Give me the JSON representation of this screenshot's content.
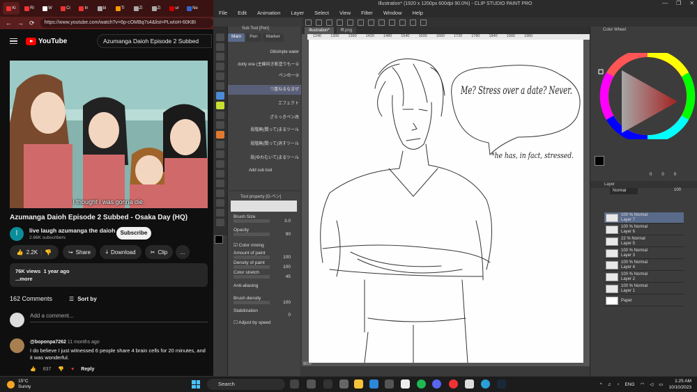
{
  "browser": {
    "tabs": [
      "Ki",
      "Rl",
      "W",
      "Ci",
      "In",
      "bi",
      "Tl",
      "Zi",
      "Zi",
      "ur",
      "Ne"
    ],
    "url": "https://www.youtube.com/watch?v=6p-cOMBq7s4&list=PLwIoH-60KBI",
    "logo": "YouTube",
    "search_value": "Azumanga Daioh Episode 2 Subbed",
    "subtitle": "I thought I was gonna die.",
    "video_title": "Azumanga Daioh Episode 2 Subbed - Osaka Day (HQ)",
    "channel_initial": "l",
    "channel_name": "live laugh azumanga the daioh",
    "subscribers": "2.66K subscribers",
    "subscribe_label": "Subscribe",
    "likes": "2.2K",
    "share_label": "Share",
    "download_label": "Download",
    "clip_label": "Clip",
    "more_label": "...",
    "views": "76K views",
    "age": "1 year ago",
    "more_desc": "...more",
    "comments_count": "162 Comments",
    "sort_label": "Sort by",
    "add_comment_placeholder": "Add a comment...",
    "comment": {
      "author": "@boponpa7262",
      "time": "11 months ago",
      "text": "I do believe I just witnessed 6 people share 4 brain cells for 20 minutes, and it was wonderful.",
      "likes": "837",
      "reply_label": "Reply"
    }
  },
  "csp": {
    "title": "Illustration* (1920 x 1200px 600dpi 90.0%) - CLIP STUDIO PAINT PRO",
    "menu": [
      "File",
      "Edit",
      "Animation",
      "Layer",
      "Select",
      "View",
      "Filter",
      "Window",
      "Help"
    ],
    "subtool_header": "Sub Tool [Pen]",
    "subtool_tabs": [
      "Main",
      "Pen",
      "Marker"
    ],
    "brushes": [
      "G8simple water",
      "dotty one (主線向き影塗りもー①",
      "ペンの一②",
      "つ重ねるなまぜ",
      "エフェクト",
      "ざらっきペン改",
      "段階無(間って)まるツール",
      "段階無(間って)消すツール",
      "段(ゆわむいて)まるツール"
    ],
    "add_subtool": "Add sub tool",
    "tool_property_header": "Tool property [G-ペン]",
    "props": {
      "brush_size_label": "Brush Size",
      "brush_size": "3.0",
      "opacity_label": "Opacity",
      "opacity": "90",
      "color_mixing_label": "Color mixing",
      "amount_label": "Amount of paint",
      "amount": "100",
      "density_label": "Density of paint",
      "density": "100",
      "stretch_label": "Color stretch",
      "stretch": "45",
      "antialias_label": "Anti-aliasing",
      "brush_density_label": "Brush density",
      "brush_density": "100",
      "stabilization_label": "Stabilization",
      "stabilization": "0",
      "adjust_speed_label": "Adjust by speed"
    },
    "canvas_tabs": [
      "Illustration*",
      "fff.png"
    ],
    "ruler_ticks": [
      "1240",
      "1300",
      "1360",
      "1420",
      "1480",
      "1540",
      "1600",
      "1660",
      "1720",
      "1780",
      "1840",
      "1900",
      "1960"
    ],
    "speech_main": "Me? Stress over a date? Never.",
    "speech_note": "*he has, in fact, stressed.",
    "zoom": "90.0",
    "color_wheel_label": "Color Wheel",
    "color_values": [
      "0",
      "0",
      "0"
    ],
    "layer_panel_label": "Layer",
    "blend_mode": "Normal",
    "layer_opacity": "100",
    "layers": [
      {
        "opacity": "100 % Normal",
        "name": "Layer 7"
      },
      {
        "opacity": "100 % Normal",
        "name": "Layer 6"
      },
      {
        "opacity": "22 % Normal",
        "name": "Layer 5"
      },
      {
        "opacity": "100 % Normal",
        "name": "Layer 3"
      },
      {
        "opacity": "100 % Normal",
        "name": "Layer 4"
      },
      {
        "opacity": "100 % Normal",
        "name": "Layer 2"
      },
      {
        "opacity": "100 % Normal",
        "name": "Layer 1"
      },
      {
        "opacity": "",
        "name": "Paper"
      }
    ]
  },
  "taskbar": {
    "temp": "15°C",
    "weather": "Sunny",
    "search_placeholder": "Search",
    "lang": "ENG",
    "time": "1:25 AM",
    "date": "10/10/2023"
  },
  "colors": {
    "yt_red": "#ff0000",
    "tab_bg": "#3a1212",
    "csp_select": "#5a6a8a"
  }
}
